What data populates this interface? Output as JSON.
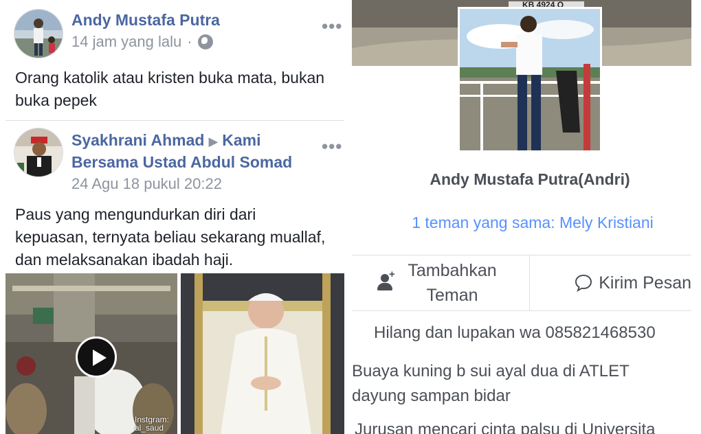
{
  "feed": {
    "posts": [
      {
        "author": "Andy Mustafa Putra",
        "time": "14 jam yang lalu",
        "separator": "·",
        "privacy_icon": "globe-icon",
        "text_lines": [
          "Orang katolik atau kristen buka mata, bukan",
          "buka pepek"
        ]
      },
      {
        "author": "Syakhrani Ahmad",
        "group_line1": "Kami",
        "group_line2": "Bersama Ustad Abdul Somad",
        "time": "24 Agu 18 pukul 20:22",
        "text_lines": [
          "Paus yang mengundurkan diri dari",
          "kepuasan, ternyata beliau sekarang muallaf,",
          "dan melaksanakan ibadah haji."
        ],
        "video_watermark": "Instgram: al_saud"
      }
    ],
    "more_icon": "more-dots-icon"
  },
  "profile": {
    "name": "Andy Mustafa Putra(Andri)",
    "mutual_friends": "1 teman yang sama: Mely Kristiani",
    "add_friend_label_1": "Tambahkan",
    "add_friend_label_2": "Teman",
    "send_message_label": "Kirim Pesan",
    "bio_lines": [
      "Hilang dan lupakan wa 085821468530",
      "Buaya kuning b sui ayal dua di ATLET",
      "dayung sampan bidar",
      "Jurusan mencari cinta palsu di Universita"
    ],
    "cover_plate_text": "KB 4924 Q"
  },
  "colors": {
    "link_blue": "#4b67a1",
    "mutual_blue": "#5890ff",
    "meta_gray": "#8d949e",
    "text_dark": "#1d2129"
  }
}
